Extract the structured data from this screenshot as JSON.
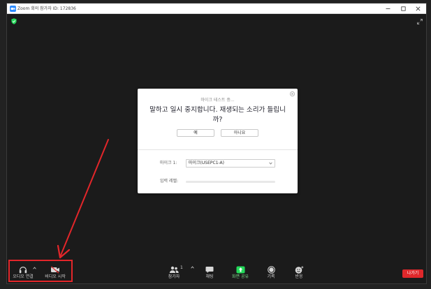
{
  "window": {
    "title": "Zoom 회의 참가자 ID: 172836",
    "logo_icon": "zoom-logo-icon",
    "controls": [
      "minimize-icon",
      "maximize-icon",
      "close-icon"
    ]
  },
  "meeting": {
    "security_icon": "shield-check-icon",
    "fullscreen_icon": "expand-icon"
  },
  "dialog": {
    "title": "마이크 테스트 중...",
    "question_lines": [
      "말하고 일시 중지합니다. 재생되는 소리가 들립니",
      "까?"
    ],
    "yes_label": "예",
    "no_label": "아니요",
    "mic_label": "마이크 1:",
    "mic_selected": "마이크(USEPC1-A)",
    "input_level_label": "입력 레벨:",
    "input_level": 0
  },
  "toolbar": {
    "left": [
      {
        "label": "오디오 연결",
        "icon": "headphone-icon"
      },
      {
        "label": "비디오 시작",
        "icon": "video-off-icon"
      }
    ],
    "center": [
      {
        "label": "참가자",
        "icon": "participants-icon"
      },
      {
        "label": "채팅",
        "icon": "chat-icon"
      },
      {
        "label": "화면 공유",
        "icon": "share-screen-icon"
      },
      {
        "label": "기록",
        "icon": "record-icon"
      },
      {
        "label": "반응",
        "icon": "reactions-icon"
      }
    ],
    "participants_count": "1",
    "leave_label": "나가기"
  },
  "colors": {
    "accent_green": "#23d959",
    "leave_red": "#e0282b",
    "annotation_red": "#e3262a"
  }
}
